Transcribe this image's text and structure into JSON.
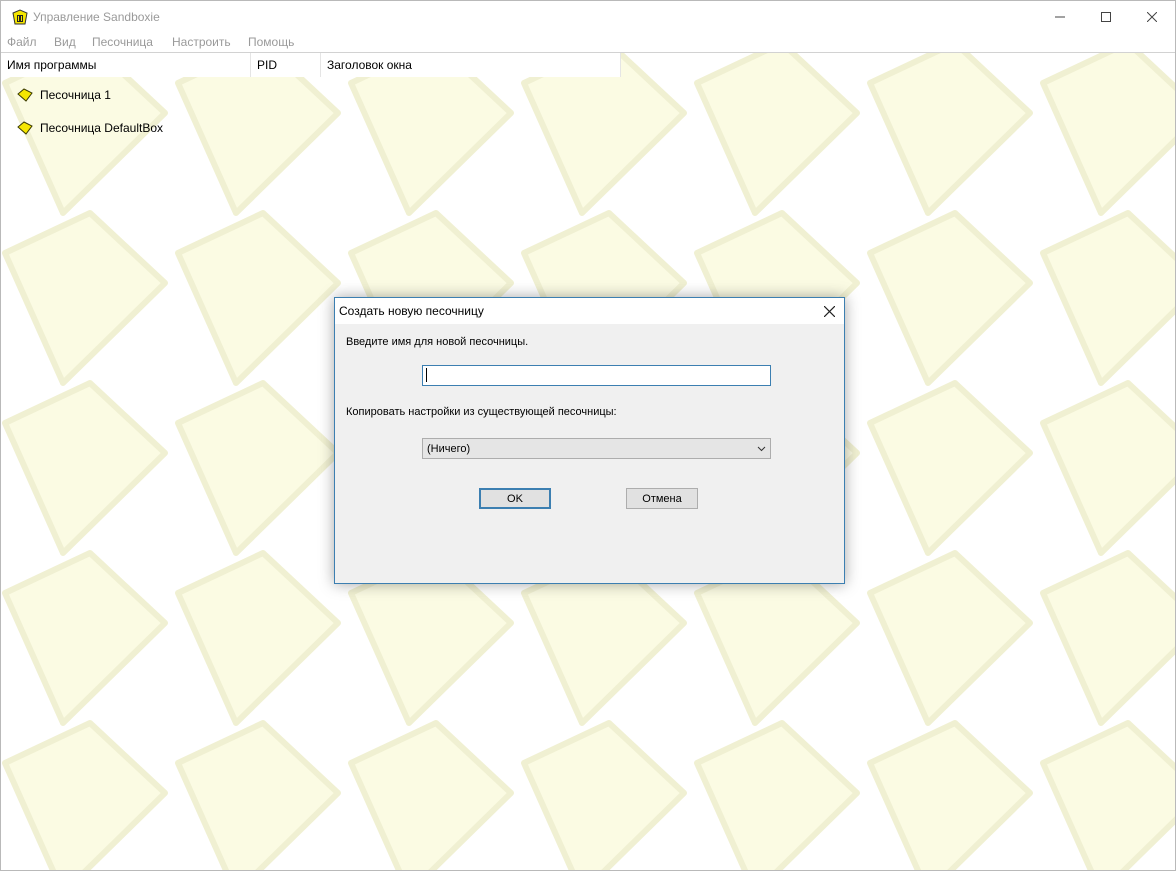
{
  "window": {
    "title": "Управление Sandboxie"
  },
  "menu": [
    "Файл",
    "Вид",
    "Песочница",
    "Настроить",
    "Помощь"
  ],
  "columns": {
    "program": "Имя программы",
    "pid": "PID",
    "window_title": "Заголовок окна"
  },
  "sandboxes": [
    {
      "label": "Песочница 1"
    },
    {
      "label": "Песочница DefaultBox"
    }
  ],
  "dialog": {
    "title": "Создать новую песочницу",
    "name_prompt": "Введите имя для новой песочницы.",
    "name_value": "",
    "copy_prompt": "Копировать настройки из существующей песочницы:",
    "copy_selected": "(Ничего)",
    "ok_label": "OK",
    "cancel_label": "Отмена"
  },
  "colors": {
    "pattern_fill": "#fbfbe3",
    "pattern_stroke": "#f0f0d2",
    "sandbox_icon": "#f5e600",
    "dialog_border": "#3c7fb1"
  },
  "icons": {
    "app": "sandboxie-app-icon",
    "sandbox": "sandbox-diamond-icon",
    "minimize": "minimize-icon",
    "maximize": "maximize-icon",
    "close": "close-icon",
    "dropdown": "chevron-down-icon"
  }
}
